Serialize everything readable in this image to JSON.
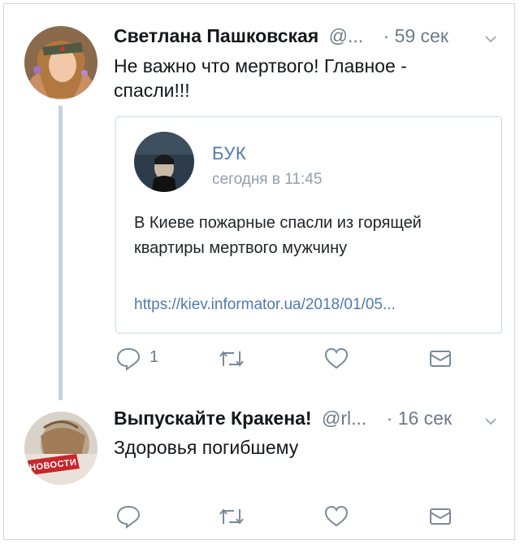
{
  "tweets": [
    {
      "name": "Светлана Пашковская",
      "handle": "@...",
      "time": "· 59 сек",
      "text": "Не важно что мертвого! Главное -\nспасли!!!",
      "reply_count": "1",
      "quoted": {
        "title": "БУК",
        "date": "сегодня в 11:45",
        "body": "В Киеве пожарные спасли из горящей квартиры мертвого мужчину",
        "link": "https://kiev.informator.ua/2018/01/05..."
      }
    },
    {
      "name": "Выпускайте Кракена!",
      "handle": "@rl...",
      "time": "· 16 сек",
      "text": "Здоровья погибшему",
      "reply_count": "",
      "avatar_label": "НОВОСТИ"
    }
  ],
  "icons": {
    "reply": "reply-icon",
    "retweet": "retweet-icon",
    "like": "heart-icon",
    "dm": "envelope-icon",
    "more": "chevron-down-icon"
  },
  "colors": {
    "icon_gray": "#7a8a99",
    "link_blue": "#4f7bb0",
    "thread_line": "#c7d3dc"
  }
}
